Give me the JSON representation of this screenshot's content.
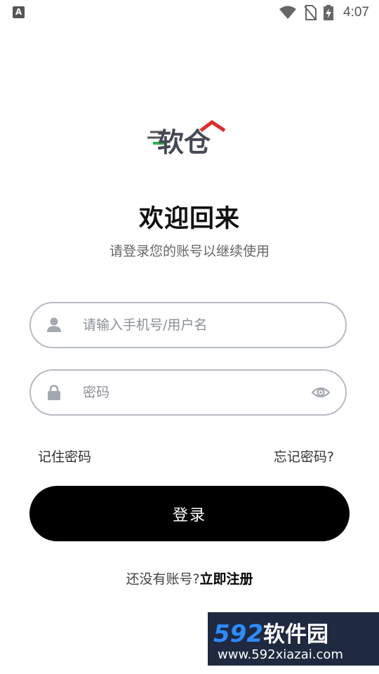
{
  "status_bar": {
    "app_icon": "A",
    "time": "4:07",
    "icons": [
      "wifi-icon",
      "no-sim-icon",
      "battery-charging-icon"
    ]
  },
  "logo": {
    "text": "软仓",
    "colors": {
      "text": "#444a54",
      "roof": "#e02b2b",
      "speed_line": "#2bb24c"
    }
  },
  "welcome": {
    "title": "欢迎回来",
    "subtitle": "请登录您的账号以继续使用"
  },
  "form": {
    "username": {
      "placeholder": "请输入手机号/用户名",
      "value": "",
      "icon": "user-icon"
    },
    "password": {
      "placeholder": "密码",
      "value": "",
      "icon": "lock-icon",
      "toggle_icon": "eye-icon"
    },
    "remember_label": "记住密码",
    "forgot_label": "忘记密码?",
    "login_label": "登录"
  },
  "signup": {
    "prompt": "还没有账号?",
    "link": "立即注册"
  },
  "watermark": {
    "brand_number": "592",
    "brand_text": "软件园",
    "url": "www.592xiazai.com"
  },
  "colors": {
    "accent": "#000000",
    "field_border": "#b7bcc4",
    "icon_gray": "#a3a8b0"
  }
}
